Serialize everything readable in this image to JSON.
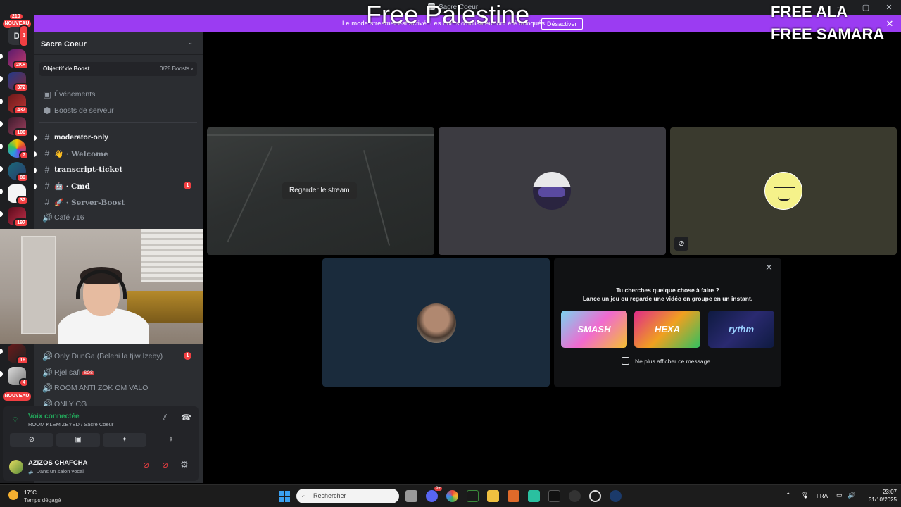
{
  "window": {
    "title": "Sacre Coeur",
    "controls": [
      "—",
      "▢",
      "✕"
    ]
  },
  "overlay": {
    "free_palestine": "Free Palestine",
    "free_ala": "FREE ALA",
    "free_samara": "FREE SAMARA"
  },
  "banner": {
    "text": "Le mode streamer est activé. Les noms d'utilisateur ont été tronqués.",
    "button": "Désactiver",
    "close": "✕"
  },
  "rail": {
    "top_badge": "210",
    "new_label": "NOUVEAU",
    "new_label_bottom": "NOUVEAU",
    "dm_letter": "D",
    "badges": [
      "1",
      "2K+",
      "372",
      "437",
      "106",
      "7",
      "89",
      "37",
      "197",
      "16",
      "4"
    ]
  },
  "server": {
    "name": "Sacre Coeur",
    "boost_goal": "Objectif de Boost",
    "boost_count": "0/28 Boosts",
    "events": "Événements",
    "server_boosts": "Boosts de serveur"
  },
  "channels": [
    {
      "label": "moderator-only",
      "emoji": ""
    },
    {
      "label": "· Welcome",
      "emoji": "👋"
    },
    {
      "label": "transcript-ticket",
      "emoji": ""
    },
    {
      "label": "· Cmd",
      "emoji": "🤖",
      "ping": "1"
    },
    {
      "label": "· Server-Boost",
      "emoji": "🚀"
    },
    {
      "label": "Café 716"
    }
  ],
  "voice_channels": [
    {
      "label": "Only DunGa (Belehi la tjiw Izeby)",
      "ping": "1"
    },
    {
      "label": "Rjel safi",
      "tag": "SOS"
    },
    {
      "label": "ROOM ANTI ZOK OM VALO"
    },
    {
      "label": "ONLY CG"
    }
  ],
  "voice": {
    "status": "Voix connectée",
    "room": "ROOM KLEM ZEYED / Sacre Coeur"
  },
  "user": {
    "name": "AZIZOS CHAFCHA",
    "status": "Dans un salon vocal"
  },
  "stage": {
    "watch_stream": "Regarder le stream"
  },
  "activity": {
    "line1": "Tu cherches quelque chose à faire ?",
    "line2": "Lance un jeu ou regarde une vidéo en groupe en un instant.",
    "games": [
      "SMASH KARTS",
      "HEXA",
      "rythm"
    ],
    "checkbox": "Ne plus afficher ce message.",
    "close": "✕"
  },
  "taskbar": {
    "temp": "17°C",
    "weather": "Temps dégagé",
    "search_placeholder": "Rechercher",
    "lang": "FRA",
    "time": "23:07",
    "date": "31/10/2025",
    "discord_badge": "9+"
  },
  "colors": {
    "accent": "#9b3cf2",
    "connected": "#23a55a",
    "badge": "#f23f42"
  }
}
